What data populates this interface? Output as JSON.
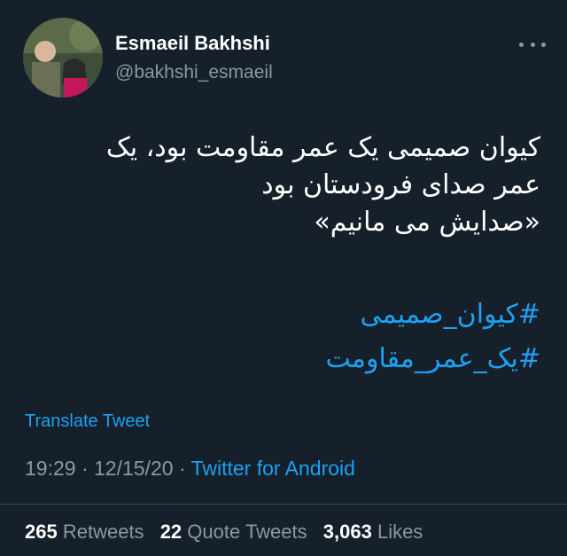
{
  "author": {
    "name": "Esmaeil Bakhshi",
    "handle": "@bakhshi_esmaeil"
  },
  "tweet": {
    "lines": [
      "کیوان صمیمی یک عمر مقاومت بود، یک",
      "عمر صدای فرودستان بود",
      "«صدایش می مانیم»"
    ],
    "hashtags": [
      "#کیوان_صمیمی",
      "#یک_عمر_مقاومت"
    ],
    "translate_label": "Translate Tweet",
    "time": "19:29",
    "date": "12/15/20",
    "separator": "·",
    "client": "Twitter for Android"
  },
  "stats": {
    "retweets_count": "265",
    "retweets_label": "Retweets",
    "quotes_count": "22",
    "quotes_label": "Quote Tweets",
    "likes_count": "3,063",
    "likes_label": "Likes"
  },
  "icons": {
    "more": "more-horizontal-icon"
  },
  "colors": {
    "background": "#15202b",
    "link": "#1da1f2",
    "secondary_text": "#8899a6",
    "primary_text": "#ffffff"
  }
}
